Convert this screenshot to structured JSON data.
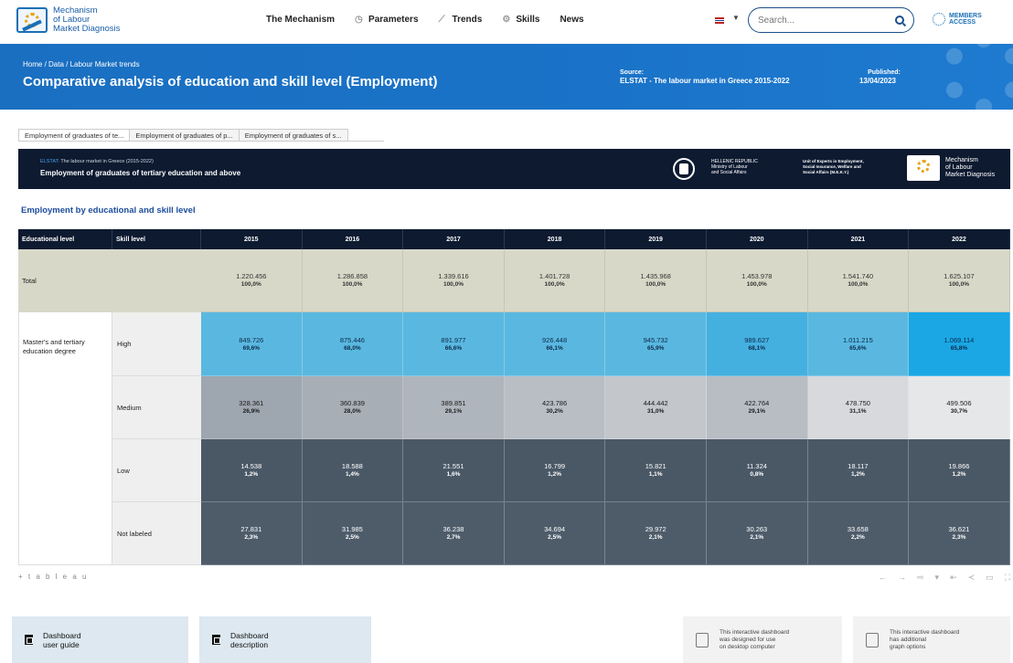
{
  "header": {
    "logo_lines": [
      "Mechanism",
      "of Labour",
      "Market Diagnosis"
    ],
    "nav": [
      {
        "label": "The Mechanism",
        "icon": ""
      },
      {
        "label": "Parameters",
        "icon": "clock-icon"
      },
      {
        "label": "Trends",
        "icon": "trend-icon"
      },
      {
        "label": "Skills",
        "icon": "gear-icon"
      },
      {
        "label": "News",
        "icon": ""
      }
    ],
    "language_flag": "uk-flag-icon",
    "search_placeholder": "Search...",
    "members_lines": [
      "MEMBERS",
      "ACCESS"
    ]
  },
  "banner": {
    "breadcrumb": "Home / Data / Labour Market trends",
    "title": "Comparative analysis of education and skill level (Employment)",
    "source_label": "Source:",
    "source_value": "ELSTAT - The labour market in Greece 2015-2022",
    "published_label": "Published:",
    "published_value": "13/04/2023"
  },
  "tabs": [
    "Employment of graduates of te...",
    "Employment of graduates of p...",
    "Employment of graduates of s..."
  ],
  "dashboard": {
    "subtitle_prefix": "ELSTAT:",
    "subtitle_rest": " The labour market in Greece (2015-2022)",
    "title": "Employment of graduates of tertiary education and above",
    "gr_lines": [
      "HELLENIC REPUBLIC",
      "Ministry of Labour",
      "and Social Affairs"
    ],
    "unit_lines": [
      "Unit of Experts in Employment,",
      "Social Insurance, Welfare and",
      "Social Affairs (M.E.K.Y.)"
    ],
    "logo_lines": [
      "Mechanism",
      "of Labour",
      "Market Diagnosis"
    ]
  },
  "section_title": "Employment by educational and skill level",
  "table": {
    "headers": {
      "edu": "Educational level",
      "skill": "Skill level"
    },
    "years": [
      "2015",
      "2016",
      "2017",
      "2018",
      "2019",
      "2020",
      "2021",
      "2022"
    ],
    "total_label": "Total",
    "total": [
      {
        "v": "1.220.456",
        "p": "100,0%"
      },
      {
        "v": "1.286.858",
        "p": "100,0%"
      },
      {
        "v": "1.339.616",
        "p": "100,0%"
      },
      {
        "v": "1.401.728",
        "p": "100,0%"
      },
      {
        "v": "1.435.968",
        "p": "100,0%"
      },
      {
        "v": "1.453.978",
        "p": "100,0%"
      },
      {
        "v": "1.541.740",
        "p": "100,0%"
      },
      {
        "v": "1.625.107",
        "p": "100,0%"
      }
    ],
    "group_label": "Master's and tertiary education degree",
    "rows": [
      {
        "skill": "High",
        "cells": [
          {
            "v": "849.726",
            "p": "69,6%",
            "bg": "#5ab8e0"
          },
          {
            "v": "875.446",
            "p": "68,0%",
            "bg": "#5ab8e0"
          },
          {
            "v": "891.977",
            "p": "66,6%",
            "bg": "#5ab8e0"
          },
          {
            "v": "926.448",
            "p": "66,1%",
            "bg": "#5ab8e0"
          },
          {
            "v": "945.732",
            "p": "65,9%",
            "bg": "#5ab8e0"
          },
          {
            "v": "989.627",
            "p": "68,1%",
            "bg": "#44b0e0"
          },
          {
            "v": "1.011.215",
            "p": "65,6%",
            "bg": "#5ab8e0"
          },
          {
            "v": "1.069.114",
            "p": "65,8%",
            "bg": "#1aa7e4"
          }
        ]
      },
      {
        "skill": "Medium",
        "cells": [
          {
            "v": "328.361",
            "p": "26,9%",
            "bg": "#9ea6af"
          },
          {
            "v": "360.839",
            "p": "28,0%",
            "bg": "#a7aeb6"
          },
          {
            "v": "389.851",
            "p": "29,1%",
            "bg": "#afb5bc"
          },
          {
            "v": "423.786",
            "p": "30,2%",
            "bg": "#b9bec4"
          },
          {
            "v": "444.442",
            "p": "31,0%",
            "bg": "#c3c7cc"
          },
          {
            "v": "422.764",
            "p": "29,1%",
            "bg": "#b8bdc3"
          },
          {
            "v": "478.750",
            "p": "31,1%",
            "bg": "#d7d9dc"
          },
          {
            "v": "499.506",
            "p": "30,7%",
            "bg": "#e6e7e9"
          }
        ]
      },
      {
        "skill": "Low",
        "cells": [
          {
            "v": "14.538",
            "p": "1,2%",
            "bg": "#4a5866"
          },
          {
            "v": "18.588",
            "p": "1,4%",
            "bg": "#4a5866"
          },
          {
            "v": "21.551",
            "p": "1,6%",
            "bg": "#4a5866"
          },
          {
            "v": "16.799",
            "p": "1,2%",
            "bg": "#4a5866"
          },
          {
            "v": "15.821",
            "p": "1,1%",
            "bg": "#4a5866"
          },
          {
            "v": "11.324",
            "p": "0,8%",
            "bg": "#4a5866"
          },
          {
            "v": "18.117",
            "p": "1,2%",
            "bg": "#4a5866"
          },
          {
            "v": "19.866",
            "p": "1,2%",
            "bg": "#4a5866"
          }
        ]
      },
      {
        "skill": "Not labeled",
        "cells": [
          {
            "v": "27.831",
            "p": "2,3%",
            "bg": "#4e5c6a"
          },
          {
            "v": "31.985",
            "p": "2,5%",
            "bg": "#4e5c6a"
          },
          {
            "v": "36.238",
            "p": "2,7%",
            "bg": "#4e5c6a"
          },
          {
            "v": "34.694",
            "p": "2,5%",
            "bg": "#4e5c6a"
          },
          {
            "v": "29.972",
            "p": "2,1%",
            "bg": "#4e5c6a"
          },
          {
            "v": "30.263",
            "p": "2,1%",
            "bg": "#4e5c6a"
          },
          {
            "v": "33.658",
            "p": "2,2%",
            "bg": "#4e5c6a"
          },
          {
            "v": "36.621",
            "p": "2,3%",
            "bg": "#4e5c6a"
          }
        ]
      }
    ]
  },
  "tableau": {
    "logo": "+ t a b l e a u",
    "tools": [
      "undo-icon",
      "redo-icon",
      "revert-icon",
      "pause-icon",
      "share-icon",
      "comment-icon",
      "fullscreen-icon"
    ]
  },
  "cards": [
    {
      "lines": [
        "Dashboard",
        "user guide"
      ]
    },
    {
      "lines": [
        "Dashboard",
        "description"
      ]
    }
  ],
  "info": [
    {
      "lines": [
        "This interactive dashboard",
        "was designed for use",
        "on desktop computer"
      ]
    },
    {
      "lines": [
        "This interactive dashboard",
        "has additional",
        "graph options"
      ]
    }
  ],
  "colors": {
    "brand_blue": "#1a6fc1",
    "navy": "#0d1a30",
    "total_row": "#d8d8c8",
    "section_title": "#1c4c9c"
  }
}
